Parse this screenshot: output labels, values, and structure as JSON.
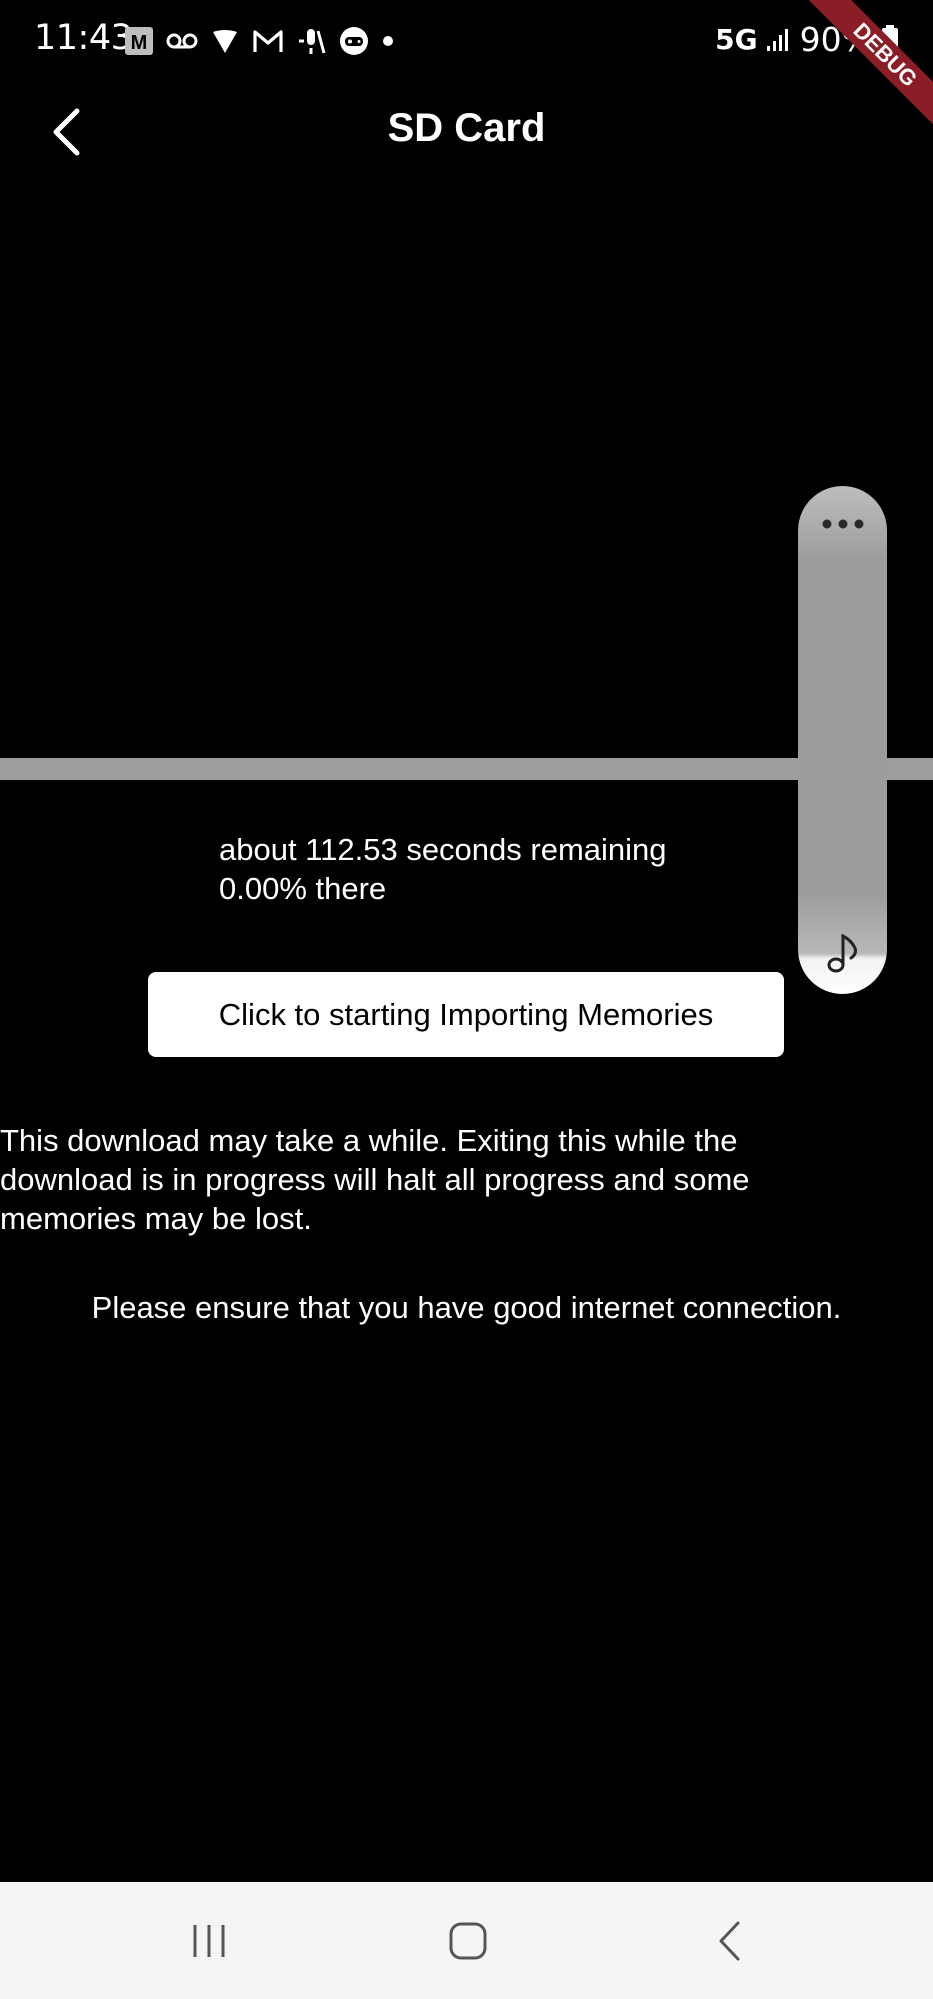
{
  "status_bar": {
    "time": "11:43",
    "network": "5G",
    "battery": "90%",
    "icons": [
      "gmail-m-icon",
      "voicemail-icon",
      "heart-shield-icon",
      "gmail-icon",
      "mic-off-icon",
      "game-controller-icon",
      "dot-icon",
      "signal-bars-icon",
      "battery-icon"
    ]
  },
  "debug_banner": "DEBUG",
  "app_bar": {
    "title": "SD Card",
    "back_icon": "chevron-left-icon"
  },
  "progress": {
    "remaining_text": "about 112.53 seconds remaining",
    "percent_text": "0.00% there",
    "fraction": 0.0
  },
  "actions": {
    "start_button_label": "Click to starting Importing Memories"
  },
  "messages": {
    "warning": "This download may take a while. Exiting this while the download is in progress will halt all progress and some memories may be lost.",
    "internet": "Please ensure that you have good internet connection."
  },
  "side_panel": {
    "menu_icon": "more-horizontal-icon",
    "music_icon": "music-note-icon"
  },
  "nav_bar": {
    "recents_icon": "recents-icon",
    "home_icon": "home-icon",
    "back_icon": "back-icon"
  },
  "colors": {
    "background": "#000000",
    "track": "#9e9e9e",
    "debug_banner": "#8a1d25",
    "nav_bar": "#f5f5f7"
  }
}
